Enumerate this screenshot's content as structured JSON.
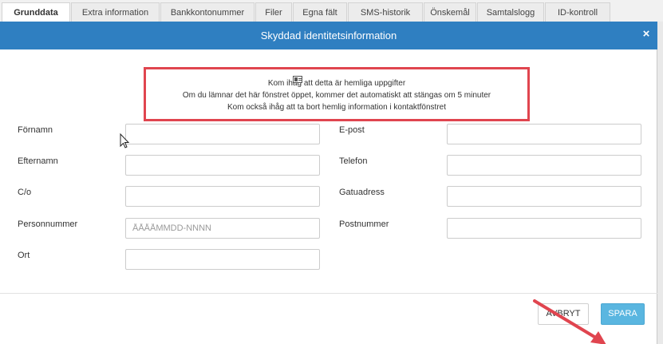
{
  "tabs": [
    {
      "label": "Grunddata",
      "active": true
    },
    {
      "label": "Extra information"
    },
    {
      "label": "Bankkontonummer"
    },
    {
      "label": "Filer"
    },
    {
      "label": "Egna fält"
    },
    {
      "label": "SMS-historik"
    },
    {
      "label": "Önskemål"
    },
    {
      "label": "Samtalslogg"
    },
    {
      "label": "ID-kontroll"
    }
  ],
  "modal": {
    "title": "Skyddad identitetsinformation",
    "close_label": "×",
    "header_color": "#2f7fc1",
    "notice": {
      "icon": "id-card-icon",
      "lines": [
        "Kom ihåg att detta är hemliga uppgifter",
        "Om du lämnar det här fönstret öppet, kommer det automatiskt att stängas om 5 minuter",
        "Kom också ihåg att ta bort hemlig information i kontaktfönstret"
      ],
      "border_color": "#e0454f"
    },
    "fields": {
      "fornamn": {
        "label": "Förnamn",
        "value": "",
        "placeholder": ""
      },
      "efternamn": {
        "label": "Efternamn",
        "value": "",
        "placeholder": ""
      },
      "co": {
        "label": "C/o",
        "value": "",
        "placeholder": ""
      },
      "personnummer": {
        "label": "Personnummer",
        "value": "",
        "placeholder": "ÅÅÅÅMMDD-NNNN"
      },
      "ort": {
        "label": "Ort",
        "value": "",
        "placeholder": ""
      },
      "epost": {
        "label": "E-post",
        "value": "",
        "placeholder": ""
      },
      "telefon": {
        "label": "Telefon",
        "value": "",
        "placeholder": ""
      },
      "gatuadress": {
        "label": "Gatuadress",
        "value": "",
        "placeholder": ""
      },
      "postnummer": {
        "label": "Postnummer",
        "value": "",
        "placeholder": ""
      }
    },
    "buttons": {
      "cancel": "AVBRYT",
      "save": "SPARA",
      "save_color": "#5ab6e0"
    }
  },
  "annotation": {
    "arrow_color": "#e0454f"
  }
}
